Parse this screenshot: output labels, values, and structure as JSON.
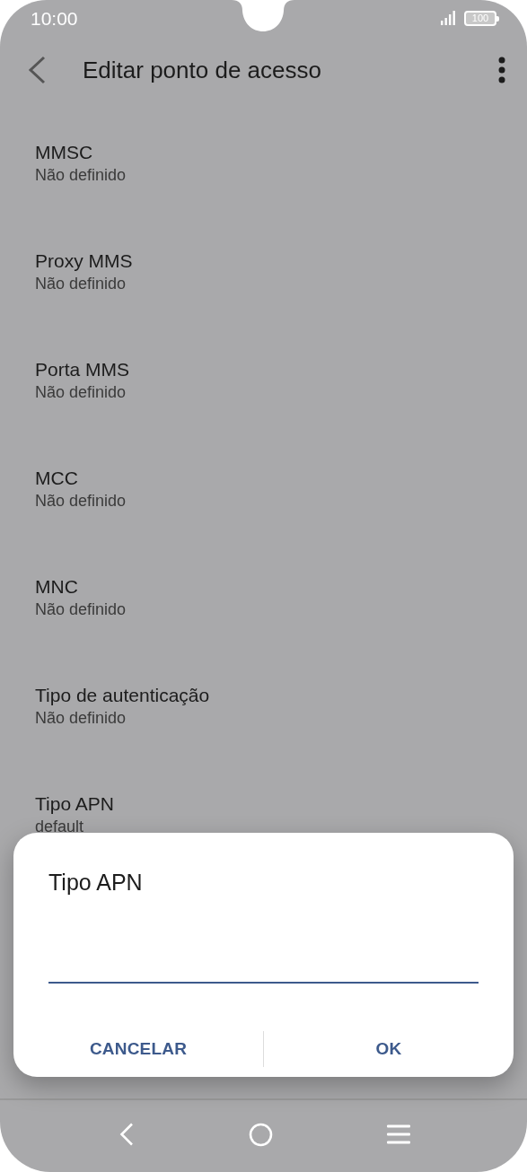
{
  "status_bar": {
    "time": "10:00",
    "battery": "100"
  },
  "toolbar": {
    "title": "Editar ponto de acesso"
  },
  "items": [
    {
      "title": "MMSC",
      "summary": "Não definido"
    },
    {
      "title": "Proxy MMS",
      "summary": "Não definido"
    },
    {
      "title": "Porta MMS",
      "summary": "Não definido"
    },
    {
      "title": "MCC",
      "summary": "Não definido"
    },
    {
      "title": "MNC",
      "summary": "Não definido"
    },
    {
      "title": "Tipo de autenticação",
      "summary": "Não definido"
    },
    {
      "title": "Tipo APN",
      "summary": "default"
    }
  ],
  "dialog": {
    "title": "Tipo APN",
    "buttons": [
      "CANCELAR",
      "OK"
    ]
  }
}
